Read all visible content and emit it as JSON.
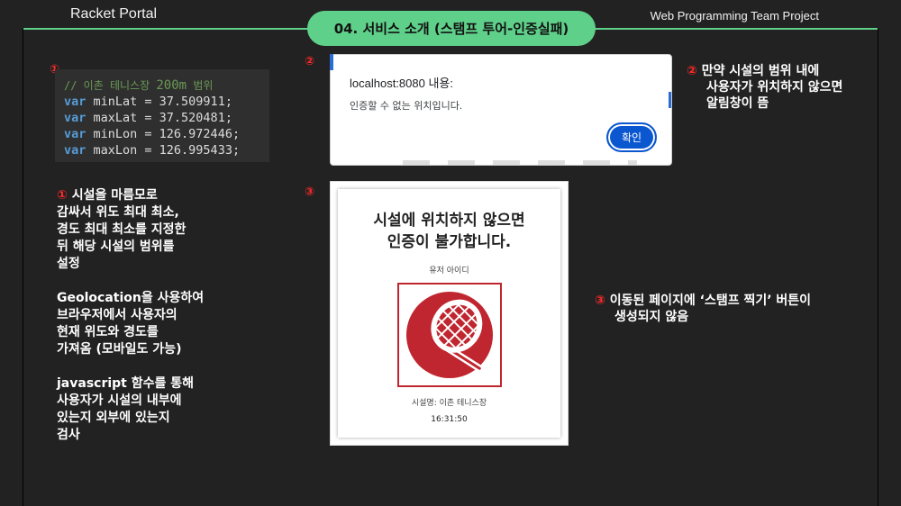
{
  "header": {
    "brand": "Racket Portal",
    "title": "04. 서비스 소개 (스탬프 투어-인증실패)",
    "team": "Web Programming Team Project"
  },
  "badges": {
    "one": "①",
    "two": "②",
    "three": "③"
  },
  "code": {
    "comment_prefix": "// 이촌 테니스장 ",
    "comment_num": "200m",
    "comment_suffix": " 범위",
    "lines": [
      {
        "kw": "var",
        "rest": " minLat = 37.509911;"
      },
      {
        "kw": "var",
        "rest": " maxLat = 37.520481;"
      },
      {
        "kw": "var",
        "rest": " minLon = 126.972446;"
      },
      {
        "kw": "var",
        "rest": " maxLon = 126.995433;"
      }
    ]
  },
  "left_description": {
    "p1": [
      "시설을 마름모로",
      "감싸서 위도 최대 최소,",
      "경도 최대 최소를 지정한",
      "뒤 해당 시설의 범위를",
      "설정"
    ],
    "p2": [
      "Geolocation을 사용하여",
      "브라우저에서 사용자의",
      "현재 위도와 경도를",
      "가져옴 (모바일도 가능)"
    ],
    "p3": [
      "javascript 함수를 통해",
      "사용자가 시설의 내부에",
      "있는지 외부에 있는지",
      "검사"
    ]
  },
  "alert_dialog": {
    "title": "localhost:8080 내용:",
    "message": "인증할 수 없는 위치입니다.",
    "ok_label": "확인"
  },
  "note2": [
    "만약 시설의 범위 내에",
    "사용자가 위치하지 않으면",
    "알림창이 뜸"
  ],
  "stamp_page": {
    "title_line1": "시설에 위치하지 않으면",
    "title_line2": "인증이 불가합니다.",
    "user_id": "유저 아이디",
    "facility": "시설명: 이촌 테니스장",
    "time": "16:31:50",
    "logo_color": "#c0262f"
  },
  "note3": [
    "이동된 페이지에 ‘스탬프 찍기’ 버튼이",
    "생성되지 않음"
  ],
  "colors": {
    "accent": "#5fd08a",
    "badge": "#ff2a2a",
    "background": "#222222"
  }
}
